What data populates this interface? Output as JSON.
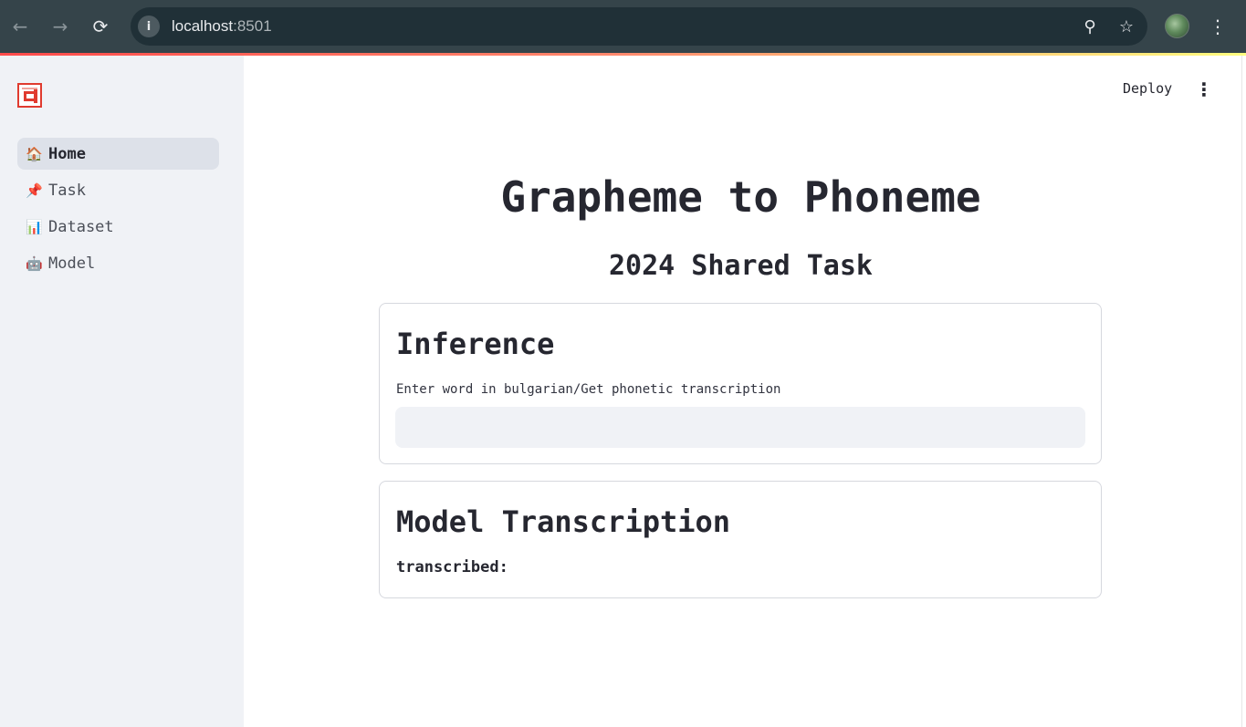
{
  "browser": {
    "url_host": "localhost",
    "url_port": ":8501",
    "back_icon": "←",
    "forward_icon": "→",
    "reload_icon": "⟳",
    "info_icon": "i",
    "zoom_icon": "⚲",
    "star_icon": "☆",
    "menu_icon": "⋮"
  },
  "sidebar": {
    "items": [
      {
        "emoji": "🏠",
        "label": "Home",
        "active": true
      },
      {
        "emoji": "📌",
        "label": "Task"
      },
      {
        "emoji": "📊",
        "label": "Dataset"
      },
      {
        "emoji": "🤖",
        "label": "Model"
      }
    ]
  },
  "header": {
    "deploy_label": "Deploy",
    "menu_icon": "⋮"
  },
  "main": {
    "title": "Grapheme to Phoneme",
    "subtitle": "2024 Shared Task",
    "inference": {
      "heading": "Inference",
      "input_label": "Enter word in bulgarian/Get phonetic transcription",
      "input_value": ""
    },
    "transcription": {
      "heading": "Model Transcription",
      "result_label": "transcribed:",
      "result_value": ""
    }
  },
  "colors": {
    "accent": "#ff4b4b",
    "sidebar_bg": "#f0f2f6",
    "text": "#262730"
  }
}
